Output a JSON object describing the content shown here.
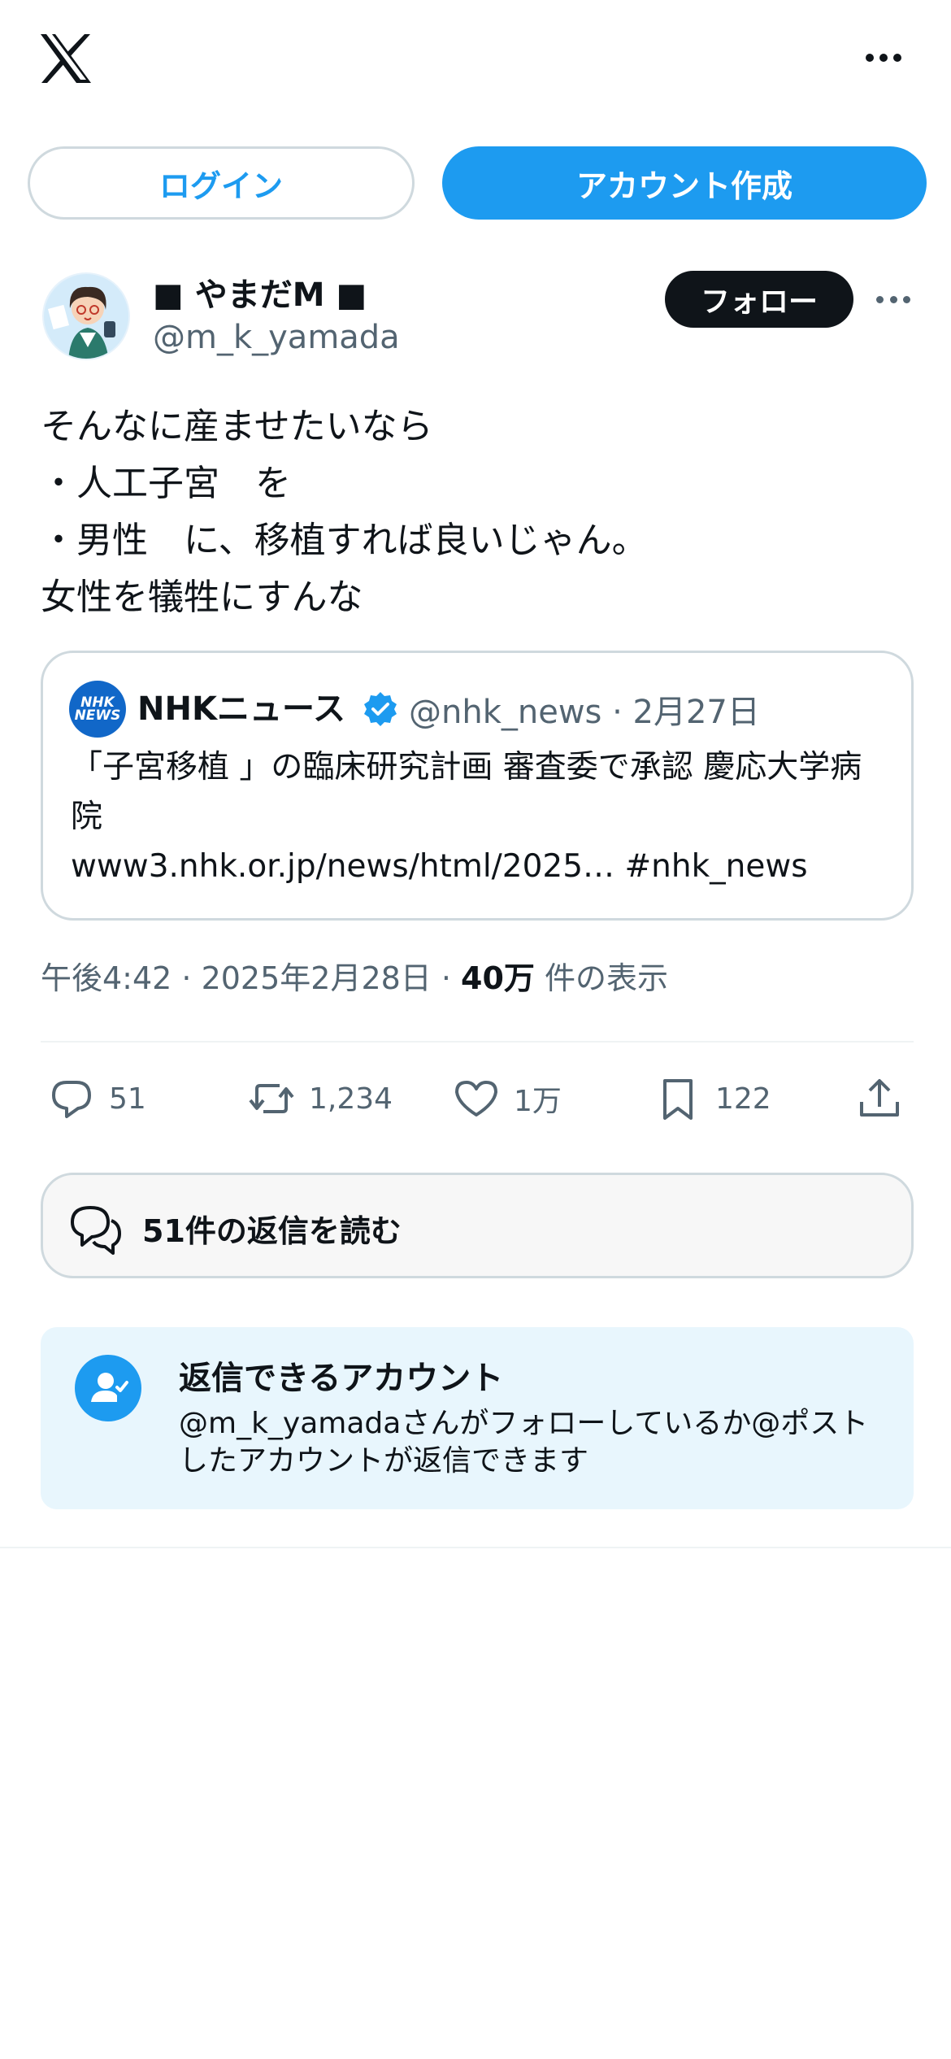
{
  "header": {
    "logo": "x-logo",
    "more": "more-icon"
  },
  "auth": {
    "login_label": "ログイン",
    "signup_label": "アカウント作成"
  },
  "post": {
    "author_name": "■ やまだM ■",
    "author_handle": "@m_k_yamada",
    "follow_label": "フォロー",
    "text_lines": [
      "そんなに産ませたいなら",
      "・人工子宮　を",
      "・男性　に、移植すれば良いじゃん。",
      "女性を犠牲にすんな"
    ],
    "quote": {
      "logo_text": [
        "NHK",
        "NEWS"
      ],
      "name": "NHKニュース",
      "meta": "@nhk_news · 2月27日",
      "text": "「子宮移植 」の臨床研究計画 審査委で承認 慶応大学病院",
      "link": "www3.nhk.or.jp/news/html/2025… #nhk_news"
    },
    "time": "午後4:42 · 2025年2月28日 · ",
    "views_count": "40万",
    "views_label": " 件の表示",
    "actions": {
      "replies": "51",
      "reposts": "1,234",
      "likes": "1万",
      "bookmarks": "122"
    }
  },
  "read_replies": {
    "label": "51件の返信を読む"
  },
  "reply_restriction": {
    "title": "返信できるアカウント",
    "description": "@m_k_yamadaさんがフォローしているか@ポストしたアカウントが返信できます"
  },
  "colors": {
    "accent": "#1d9bf0",
    "text": "#0f1419",
    "secondary": "#536471",
    "border": "#cfd9de",
    "restriction_bg": "#e8f6fd",
    "nhk_blue": "#1167c8"
  }
}
